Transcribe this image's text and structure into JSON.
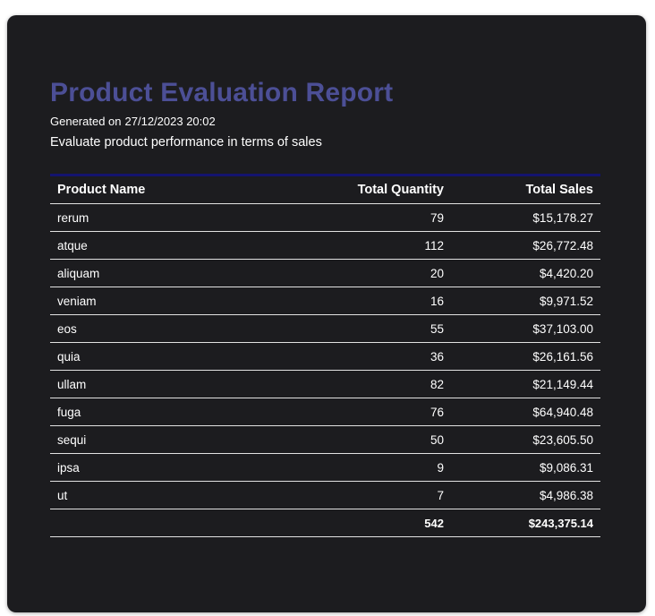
{
  "report": {
    "title": "Product Evaluation Report",
    "generated_label": "Generated on",
    "generated_date": "27/12/2023 20:02",
    "description": "Evaluate product performance in terms of sales"
  },
  "table": {
    "headers": [
      "Product Name",
      "Total Quantity",
      "Total Sales"
    ],
    "rows": [
      [
        "rerum",
        "79",
        "$15,178.27"
      ],
      [
        "atque",
        "112",
        "$26,772.48"
      ],
      [
        "aliquam",
        "20",
        "$4,420.20"
      ],
      [
        "veniam",
        "16",
        "$9,971.52"
      ],
      [
        "eos",
        "55",
        "$37,103.00"
      ],
      [
        "quia",
        "36",
        "$26,161.56"
      ],
      [
        "ullam",
        "82",
        "$21,149.44"
      ],
      [
        "fuga",
        "76",
        "$64,940.48"
      ],
      [
        "sequi",
        "50",
        "$23,605.50"
      ],
      [
        "ipsa",
        "9",
        "$9,086.31"
      ],
      [
        "ut",
        "7",
        "$4,986.38"
      ]
    ],
    "total": [
      "",
      "542",
      "$243,375.14"
    ]
  },
  "colors": {
    "background": "#1c1c1f",
    "title": "#4c4f96",
    "table_top_border": "#14146e",
    "row_divider": "#e2e2e2",
    "text": "#ffffff"
  }
}
